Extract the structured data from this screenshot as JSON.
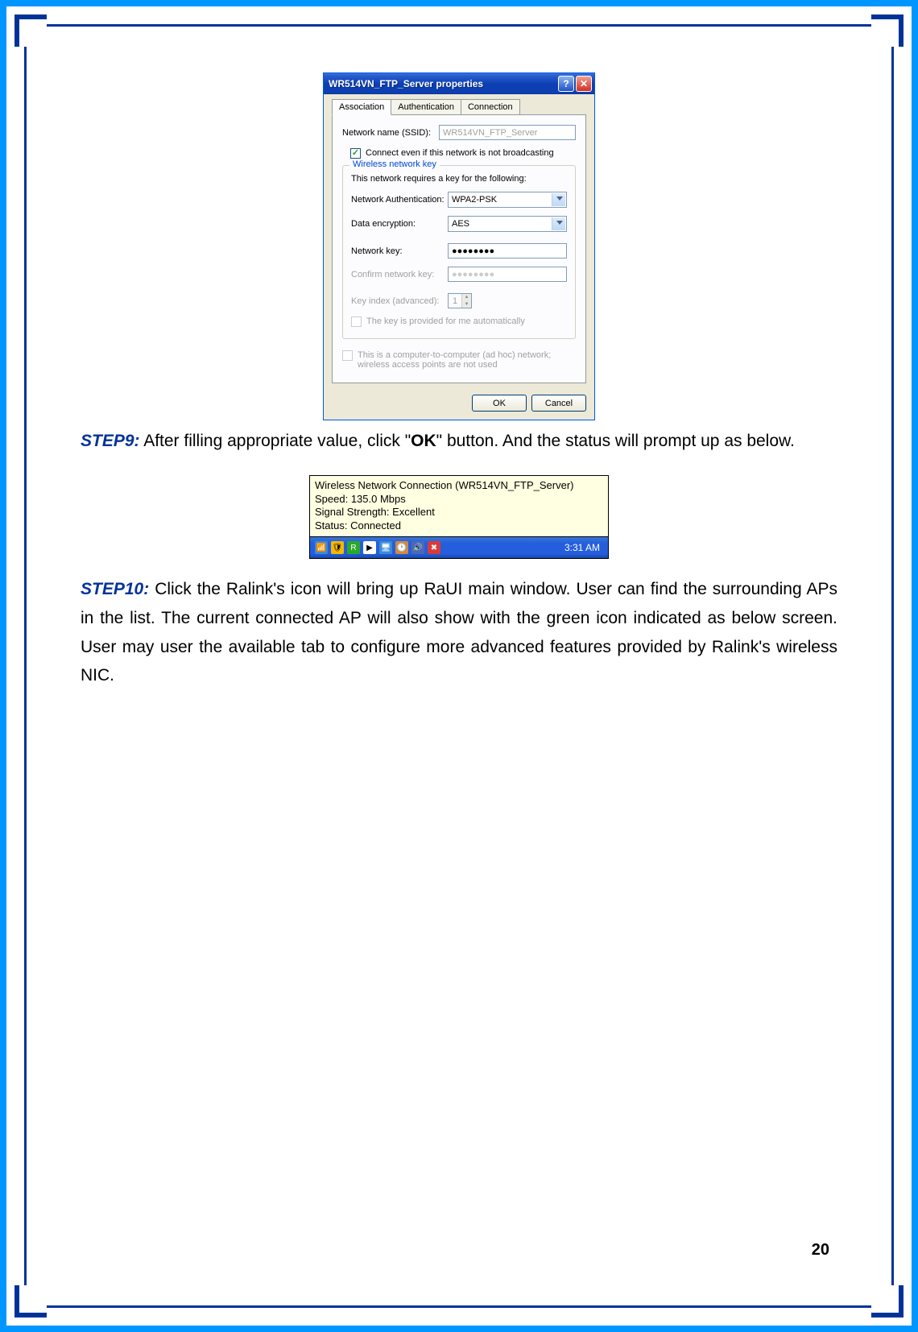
{
  "dialog": {
    "title": "WR514VN_FTP_Server properties",
    "tabs": {
      "t1": "Association",
      "t2": "Authentication",
      "t3": "Connection"
    },
    "ssid_label": "Network name (SSID):",
    "ssid_value": "WR514VN_FTP_Server",
    "connect_even": "Connect even if this network is not broadcasting",
    "fieldset_legend": "Wireless network key",
    "fieldset_text": "This network requires a key for the following:",
    "auth_label": "Network Authentication:",
    "auth_value": "WPA2-PSK",
    "enc_label": "Data encryption:",
    "enc_value": "AES",
    "key_label": "Network key:",
    "key_value": "●●●●●●●●",
    "confirm_label": "Confirm network key:",
    "confirm_value": "●●●●●●●●",
    "index_label": "Key index (advanced):",
    "index_value": "1",
    "auto_key": "The key is provided for me automatically",
    "adhoc": "This is a computer-to-computer (ad hoc) network; wireless access points are not used",
    "ok": "OK",
    "cancel": "Cancel"
  },
  "step9": {
    "label": "STEP9:",
    "text_before": " After filling appropriate value, click \"",
    "ok": "OK",
    "text_after": "\" button. And the status will prompt up as below."
  },
  "tooltip": {
    "line1": "Wireless Network Connection (WR514VN_FTP_Server)",
    "line2": "Speed: 135.0 Mbps",
    "line3": "Signal Strength: Excellent",
    "line4": "Status: Connected",
    "time": "3:31 AM"
  },
  "step10": {
    "label": "STEP10:",
    "text": " Click the Ralink's icon will bring up RaUI main window. User can find the surrounding APs in the list. The current connected AP will also show with the green icon indicated as below screen. User may user the available tab to configure more advanced features provided by Ralink's wireless NIC."
  },
  "page_number": "20"
}
